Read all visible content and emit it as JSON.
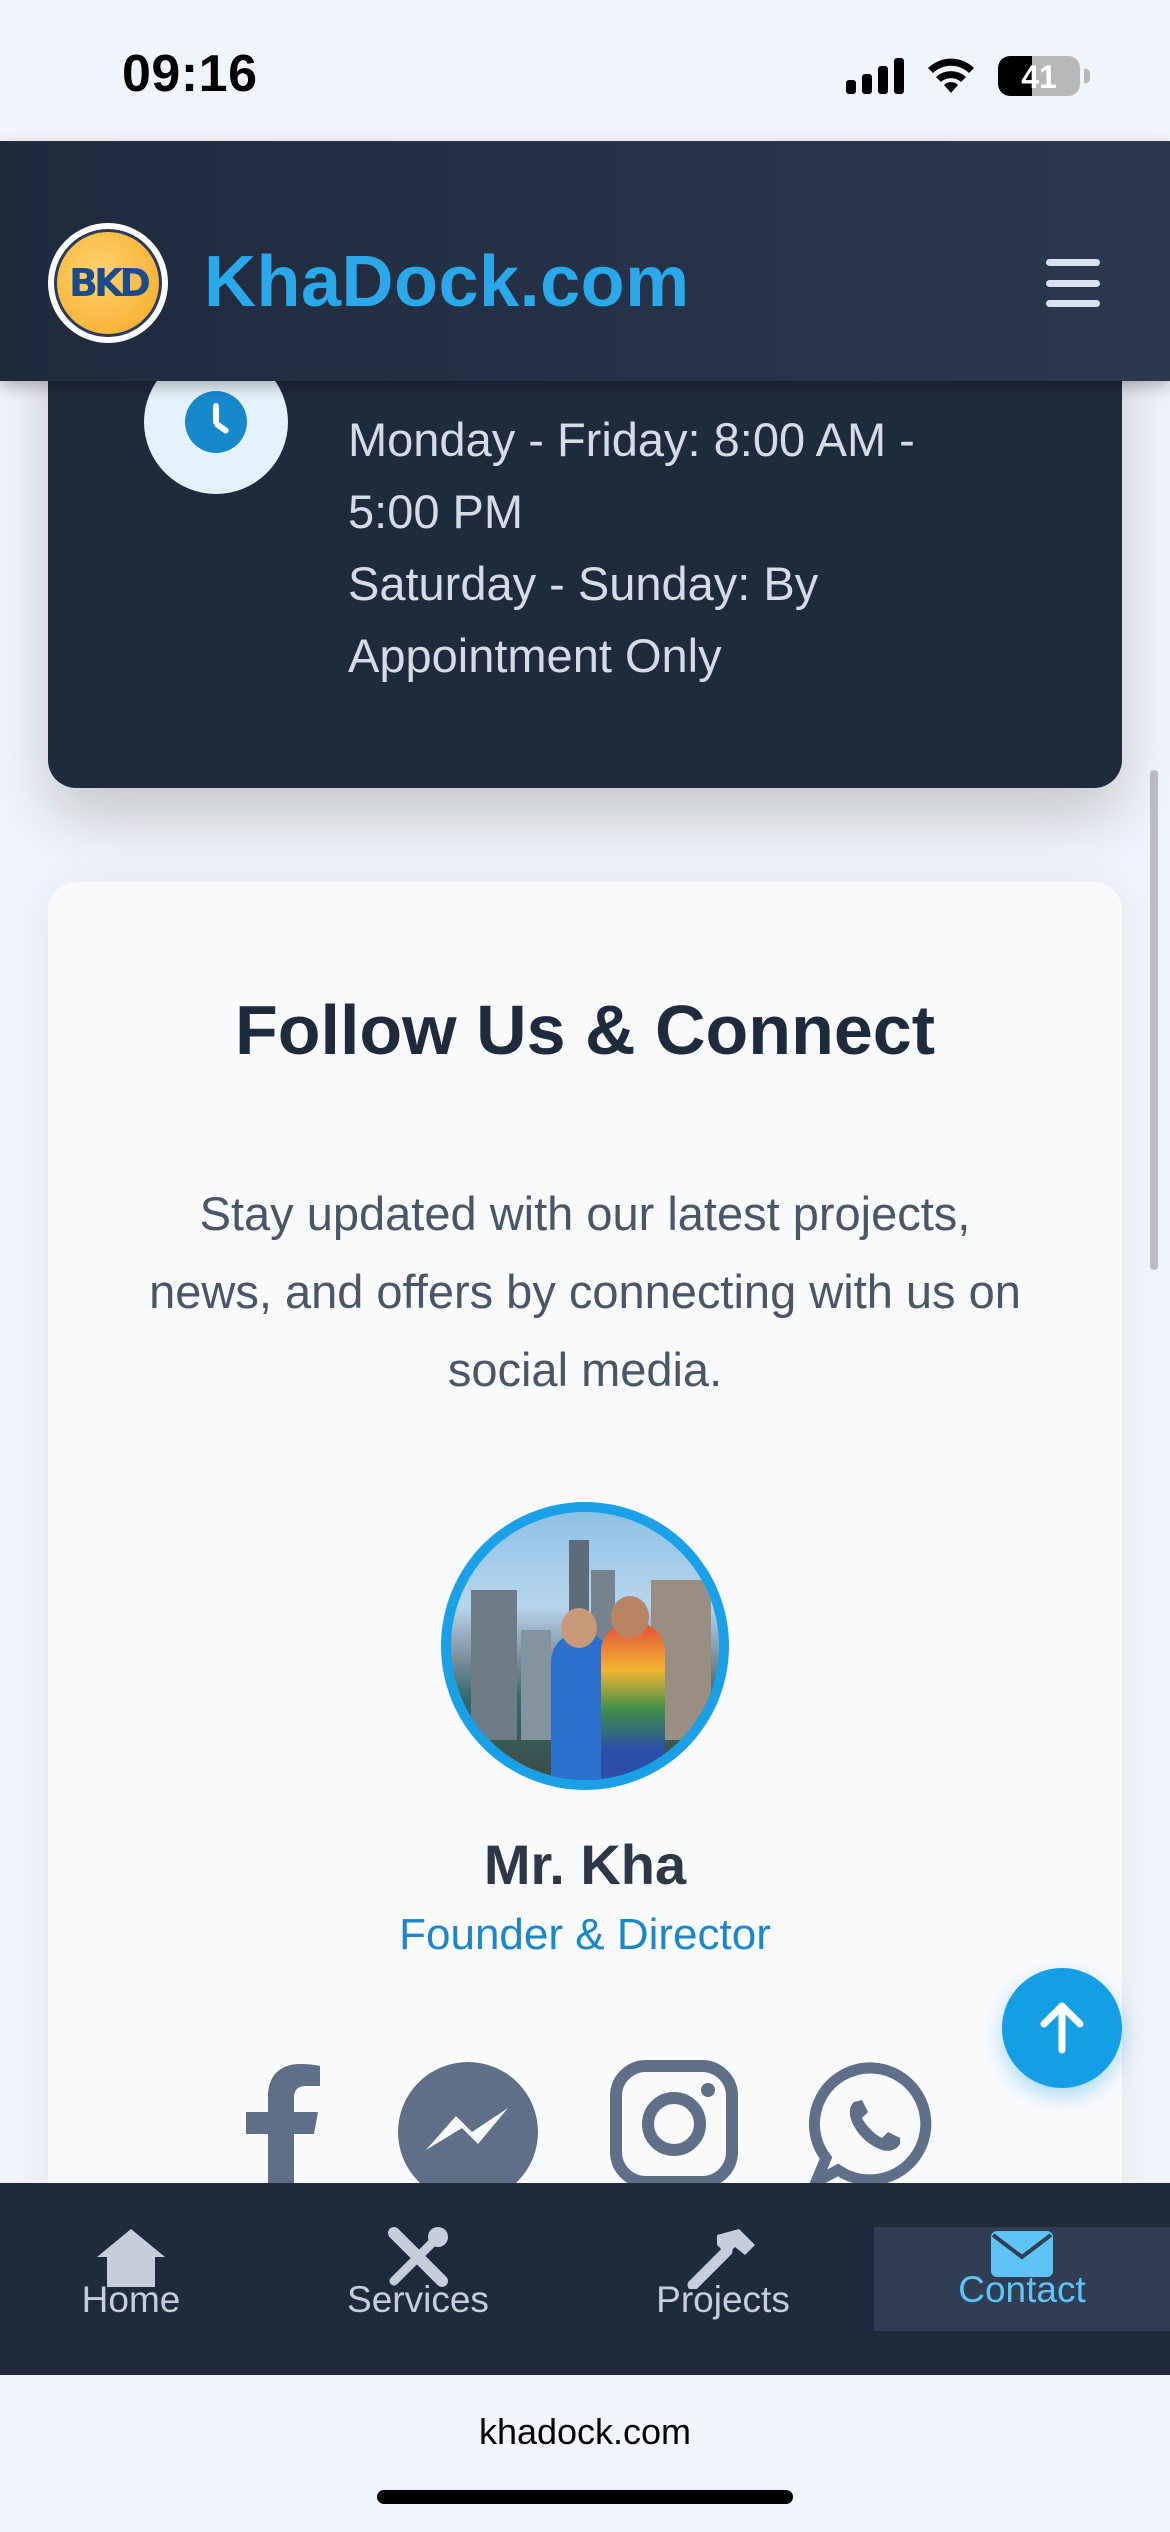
{
  "status_bar": {
    "time": "09:16",
    "battery_level": "41",
    "icons": [
      "signal-icon",
      "wifi-icon",
      "battery-icon"
    ]
  },
  "header": {
    "logo_text": "BKD",
    "brand": "KhaDock.com",
    "menu_icon": "hamburger-icon"
  },
  "hours": {
    "icon": "clock-icon",
    "lines": [
      "Monday - Friday: 8:00 AM -",
      "5:00 PM",
      "Saturday - Sunday: By",
      "Appointment Only"
    ]
  },
  "follow": {
    "title": "Follow Us & Connect",
    "description": "Stay updated with our latest projects, news, and offers by connecting with us on social media.",
    "person": {
      "name": "Mr. Kha",
      "role": "Founder & Director"
    },
    "social_icons": [
      "facebook-icon",
      "messenger-icon",
      "instagram-icon",
      "whatsapp-icon"
    ]
  },
  "scroll_top_icon": "arrow-up-icon",
  "bottom_nav": {
    "items": [
      {
        "label": "Home",
        "icon": "home-icon"
      },
      {
        "label": "Services",
        "icon": "tools-icon"
      },
      {
        "label": "Projects",
        "icon": "hammer-icon"
      },
      {
        "label": "Contact",
        "icon": "envelope-icon",
        "active": true
      }
    ]
  },
  "browser": {
    "url": "khadock.com"
  },
  "colors": {
    "brand_blue": "#2aa8ea",
    "header_bg": "#1f2a3d",
    "accent_active": "#5fc4f5",
    "role_blue": "#1b86c8"
  }
}
